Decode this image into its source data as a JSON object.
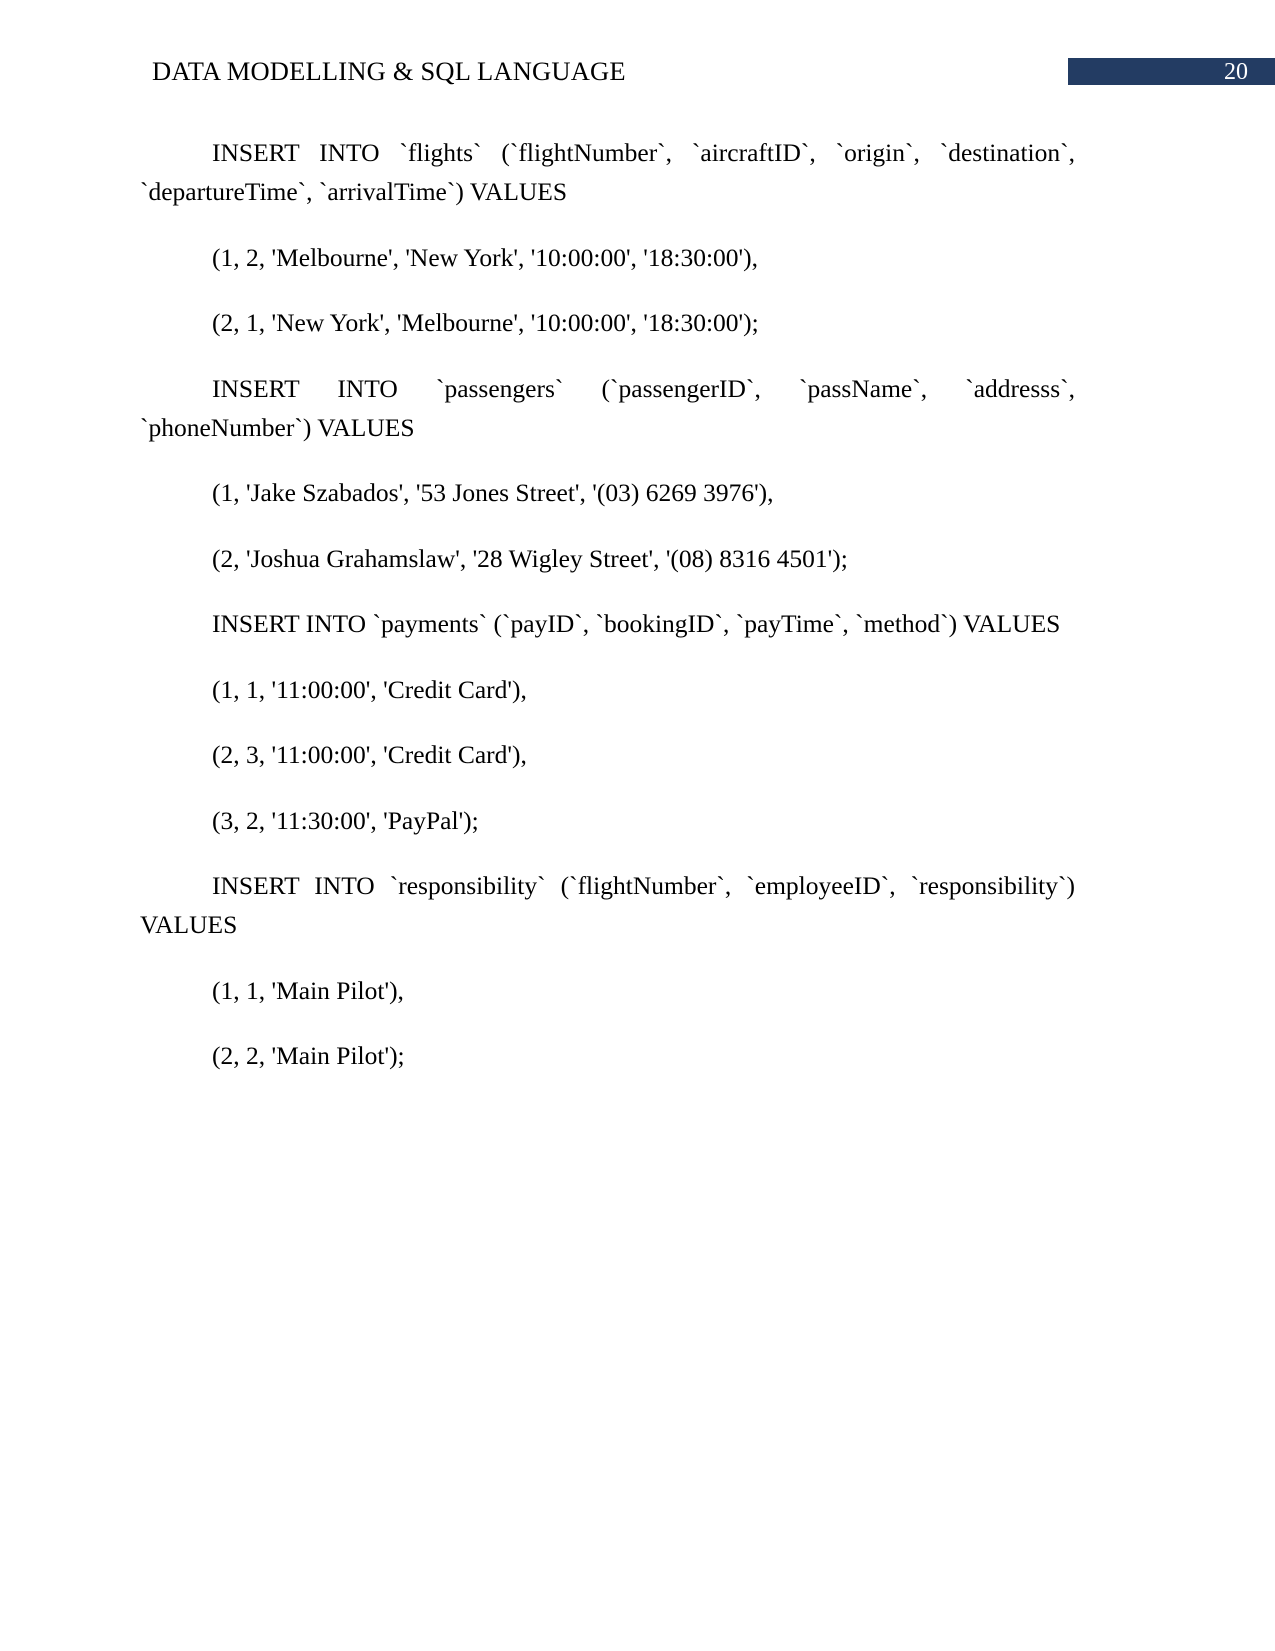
{
  "document": {
    "header": {
      "title": "DATA MODELLING & SQL LANGUAGE",
      "page_number": "20",
      "badge_color": "#233C63"
    },
    "body": {
      "paragraphs": [
        {
          "id": "insert-flights",
          "kind": "sql-statement",
          "text": "INSERT INTO `flights` (`flightNumber`, `aircraftID`, `origin`, `destination`, `departureTime`, `arrivalTime`) VALUES",
          "wrapped": true
        },
        {
          "id": "flights-row-1",
          "kind": "sql-values-row",
          "text": "(1, 2, 'Melbourne', 'New York', '10:00:00', '18:30:00'),",
          "wrapped": false
        },
        {
          "id": "flights-row-2",
          "kind": "sql-values-row",
          "text": "(2, 1, 'New York', 'Melbourne', '10:00:00', '18:30:00');",
          "wrapped": false
        },
        {
          "id": "insert-passengers",
          "kind": "sql-statement",
          "text": "INSERT INTO `passengers` (`passengerID`, `passName`, `addresss`, `phoneNumber`) VALUES",
          "wrapped": true
        },
        {
          "id": "passengers-row-1",
          "kind": "sql-values-row",
          "text": "(1, 'Jake Szabados', '53 Jones Street', '(03) 6269 3976'),",
          "wrapped": false
        },
        {
          "id": "passengers-row-2",
          "kind": "sql-values-row",
          "text": "(2, 'Joshua Grahamslaw', '28 Wigley Street', '(08) 8316 4501');",
          "wrapped": false
        },
        {
          "id": "insert-payments",
          "kind": "sql-statement",
          "text": "INSERT INTO `payments` (`payID`, `bookingID`, `payTime`, `method`) VALUES",
          "wrapped": false
        },
        {
          "id": "payments-row-1",
          "kind": "sql-values-row",
          "text": "(1, 1, '11:00:00', 'Credit Card'),",
          "wrapped": false
        },
        {
          "id": "payments-row-2",
          "kind": "sql-values-row",
          "text": "(2, 3, '11:00:00', 'Credit Card'),",
          "wrapped": false
        },
        {
          "id": "payments-row-3",
          "kind": "sql-values-row",
          "text": "(3, 2, '11:30:00', 'PayPal');",
          "wrapped": false
        },
        {
          "id": "insert-responsibility",
          "kind": "sql-statement",
          "text": "INSERT INTO `responsibility` (`flightNumber`, `employeeID`, `responsibility`) VALUES",
          "wrapped": true
        },
        {
          "id": "responsibility-row-1",
          "kind": "sql-values-row",
          "text": "(1, 1, 'Main Pilot'),",
          "wrapped": false
        },
        {
          "id": "responsibility-row-2",
          "kind": "sql-values-row",
          "text": "(2, 2, 'Main Pilot');",
          "wrapped": false
        }
      ]
    }
  }
}
